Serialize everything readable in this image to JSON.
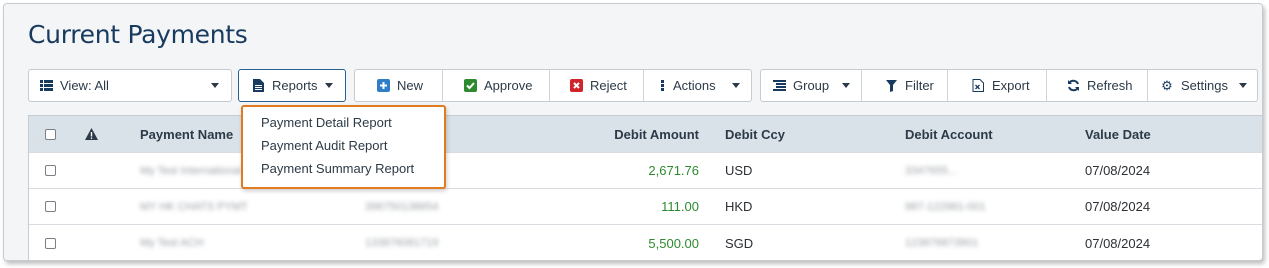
{
  "page_title": "Current Payments",
  "toolbar": {
    "view_label": "View: All",
    "reports_label": "Reports",
    "new_label": "New",
    "approve_label": "Approve",
    "reject_label": "Reject",
    "actions_label": "Actions",
    "group_label": "Group",
    "filter_label": "Filter",
    "export_label": "Export",
    "refresh_label": "Refresh",
    "settings_label": "Settings"
  },
  "reports_menu": {
    "items": [
      "Payment Detail Report",
      "Payment Audit Report",
      "Payment Summary Report"
    ]
  },
  "table": {
    "columns": {
      "payment_name": "Payment Name",
      "debit_amount": "Debit Amount",
      "debit_ccy": "Debit Ccy",
      "debit_account": "Debit Account",
      "value_date": "Value Date"
    },
    "rows": [
      {
        "payment_name": "My Test International",
        "reference": "",
        "debit_amount": "2,671.76",
        "debit_ccy": "USD",
        "debit_account": "3347655...",
        "value_date": "07/08/2024"
      },
      {
        "payment_name": "MY HK CHATS PYMT",
        "reference": "396750138654",
        "debit_amount": "111.00",
        "debit_ccy": "HKD",
        "debit_account": "987-122981-001",
        "value_date": "07/08/2024"
      },
      {
        "payment_name": "My Test ACH",
        "reference": "133876081719",
        "debit_amount": "5,500.00",
        "debit_ccy": "SGD",
        "debit_account": "123876873901",
        "value_date": "07/08/2024"
      }
    ]
  },
  "colors": {
    "title": "#173a5e",
    "amount": "#2e8a2e",
    "menu_border": "#e07b1f",
    "approve_icon": "#2e8a2e",
    "reject_icon": "#d0242b",
    "new_icon": "#2f7fc8"
  }
}
